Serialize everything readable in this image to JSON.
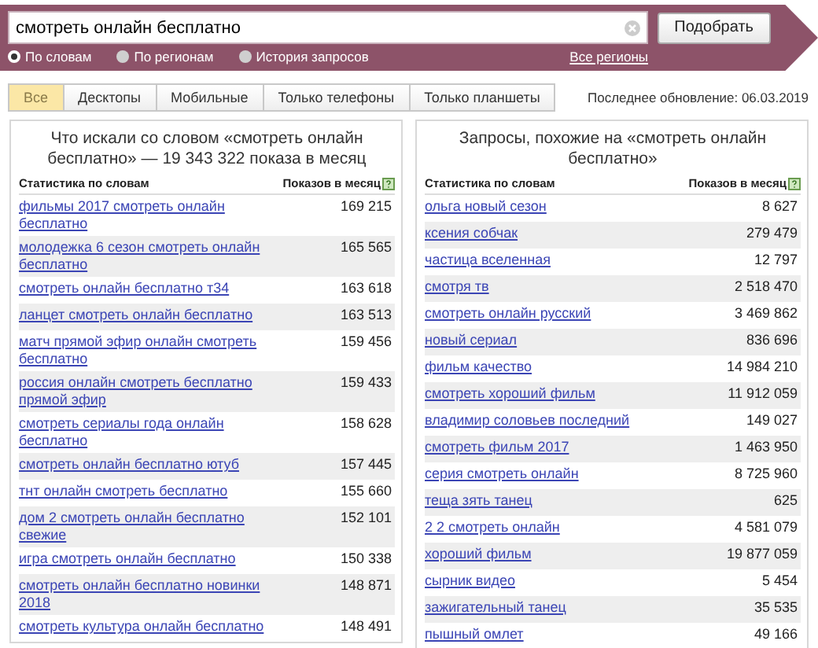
{
  "search": {
    "value": "смотреть онлайн бесплатно",
    "button": "Подобрать",
    "regions_link": "Все регионы",
    "modes": [
      {
        "label": "По словам",
        "selected": true
      },
      {
        "label": "По регионам",
        "selected": false
      },
      {
        "label": "История запросов",
        "selected": false
      }
    ]
  },
  "tabs": [
    {
      "label": "Все",
      "selected": true
    },
    {
      "label": "Десктопы",
      "selected": false
    },
    {
      "label": "Мобильные",
      "selected": false
    },
    {
      "label": "Только телефоны",
      "selected": false
    },
    {
      "label": "Только планшеты",
      "selected": false
    }
  ],
  "last_update": "Последнее обновление: 06.03.2019",
  "panels": [
    {
      "title": "Что искали со словом «смотреть онлайн бесплатно» — 19 343 322 показа в месяц",
      "columns": [
        "Статистика по словам",
        "Показов в месяц"
      ],
      "rows": [
        {
          "phrase": "фильмы 2017 смотреть онлайн бесплатно",
          "count": "169 215"
        },
        {
          "phrase": "молодежка 6 сезон смотреть онлайн бесплатно",
          "count": "165 565"
        },
        {
          "phrase": "смотреть онлайн бесплатно т34",
          "count": "163 618"
        },
        {
          "phrase": "ланцет смотреть онлайн бесплатно",
          "count": "163 513"
        },
        {
          "phrase": "матч прямой эфир онлайн смотреть бесплатно",
          "count": "159 456"
        },
        {
          "phrase": "россия онлайн смотреть бесплатно прямой эфир",
          "count": "159 433"
        },
        {
          "phrase": "смотреть сериалы года онлайн бесплатно",
          "count": "158 628"
        },
        {
          "phrase": "смотреть онлайн бесплатно ютуб",
          "count": "157 445"
        },
        {
          "phrase": "тнт онлайн смотреть бесплатно",
          "count": "155 660"
        },
        {
          "phrase": "дом 2 смотреть онлайн бесплатно свежие",
          "count": "152 101"
        },
        {
          "phrase": "игра смотреть онлайн бесплатно",
          "count": "150 338"
        },
        {
          "phrase": "смотреть онлайн бесплатно новинки 2018",
          "count": "148 871"
        },
        {
          "phrase": "смотреть культура онлайн бесплатно",
          "count": "148 491"
        }
      ]
    },
    {
      "title": "Запросы, похожие на «смотреть онлайн бесплатно»",
      "columns": [
        "Статистика по словам",
        "Показов в месяц"
      ],
      "rows": [
        {
          "phrase": "ольга новый сезон",
          "count": "8 627"
        },
        {
          "phrase": "ксения собчак",
          "count": "279 479"
        },
        {
          "phrase": "частица вселенная",
          "count": "12 797"
        },
        {
          "phrase": "смотря тв",
          "count": "2 518 470"
        },
        {
          "phrase": "смотреть онлайн русский",
          "count": "3 469 862"
        },
        {
          "phrase": "новый сериал",
          "count": "836 696"
        },
        {
          "phrase": "фильм качество",
          "count": "14 984 210"
        },
        {
          "phrase": "смотреть хороший фильм",
          "count": "11 912 059"
        },
        {
          "phrase": "владимир соловьев последний",
          "count": "149 027"
        },
        {
          "phrase": "смотреть фильм 2017",
          "count": "1 463 950"
        },
        {
          "phrase": "серия смотреть онлайн",
          "count": "8 725 960"
        },
        {
          "phrase": "теща зять танец",
          "count": "625"
        },
        {
          "phrase": "2 2 смотреть онлайн",
          "count": "4 581 079"
        },
        {
          "phrase": "хороший фильм",
          "count": "19 877 059"
        },
        {
          "phrase": "сырник видео",
          "count": "5 454"
        },
        {
          "phrase": "зажигательный танец",
          "count": "35 535"
        },
        {
          "phrase": "пышный омлет",
          "count": "49 166"
        }
      ]
    }
  ]
}
